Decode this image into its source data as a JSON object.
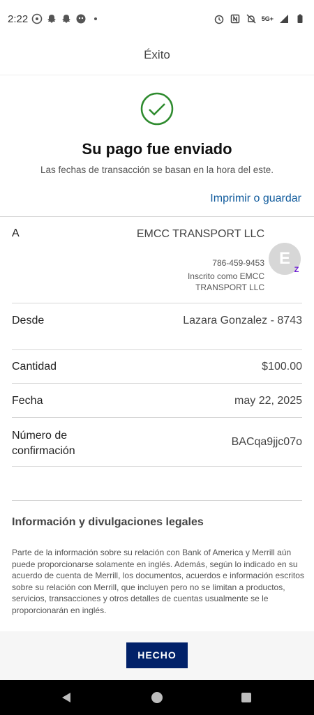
{
  "status_bar": {
    "time": "2:22",
    "network": "5G+",
    "left_icons": [
      "whatsapp-icon",
      "snapchat-icon",
      "snapchat-icon",
      "app-icon",
      "dot-icon"
    ],
    "right_icons": [
      "alarm-icon",
      "nfc-icon",
      "mute-icon",
      "signal-icon",
      "battery-icon"
    ]
  },
  "header": {
    "title": "Éxito"
  },
  "success": {
    "title": "Su pago fue enviado",
    "subtitle": "Las fechas de transacción se basan en la hora del este.",
    "print_link": "Imprimir o guardar",
    "accent_color": "#2e8b2e"
  },
  "details": {
    "to": {
      "label": "A",
      "name": "EMCC TRANSPORT LLC",
      "phone": "786-459-9453",
      "enrolled": "Inscrito como EMCC TRANSPORT LLC",
      "avatar_letter": "E",
      "badge": "Z"
    },
    "from": {
      "label": "Desde",
      "value": "Lazara Gonzalez - 8743"
    },
    "amount": {
      "label": "Cantidad",
      "value": "$100.00"
    },
    "date": {
      "label": "Fecha",
      "value": "may 22, 2025"
    },
    "confirmation": {
      "label": "Número de confirmación",
      "value": "BACqa9jjc07o"
    }
  },
  "legal": {
    "title": "Información y divulgaciones legales",
    "text": "Parte de la información sobre su relación con Bank of America y Merrill aún puede proporcionarse solamente en inglés. Además, según lo indicado en su acuerdo de cuenta de Merrill, los documentos, acuerdos e información escritos sobre su relación con Merrill, que incluyen pero no se limitan a productos, servicios, transacciones y otros detalles de cuentas usualmente se le proporcionarán en inglés."
  },
  "footer": {
    "done_label": "HECHO",
    "button_color": "#012169"
  },
  "colors": {
    "link": "#0f5a9c",
    "zelle": "#6d1ed4"
  }
}
